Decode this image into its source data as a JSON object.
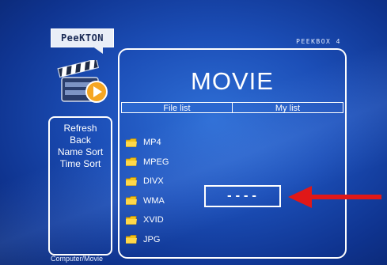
{
  "brand": {
    "logo_text": "PeeKTON",
    "model_text": "PEEKBOX 4"
  },
  "header": {
    "title": "MOVIE"
  },
  "tabs": [
    {
      "label": "File list",
      "active": true
    },
    {
      "label": "My list",
      "active": false
    }
  ],
  "sidebar": {
    "items": [
      {
        "label": "Refresh"
      },
      {
        "label": "Back"
      },
      {
        "label": "Name Sort"
      },
      {
        "label": "Time Sort"
      }
    ]
  },
  "files": [
    {
      "name": "MP4",
      "icon": "folder-icon"
    },
    {
      "name": "MPEG",
      "icon": "folder-icon"
    },
    {
      "name": "DIVX",
      "icon": "folder-icon"
    },
    {
      "name": "WMA",
      "icon": "folder-icon"
    },
    {
      "name": "XVID",
      "icon": "folder-icon"
    },
    {
      "name": "JPG",
      "icon": "folder-icon"
    }
  ],
  "status": {
    "text": "----"
  },
  "breadcrumb": {
    "path": "Computer/Movie"
  },
  "colors": {
    "background": "#1c4fb8",
    "arrow": "#e01818",
    "folder": "#f2c21a",
    "tab_active": "#2b67cf"
  }
}
